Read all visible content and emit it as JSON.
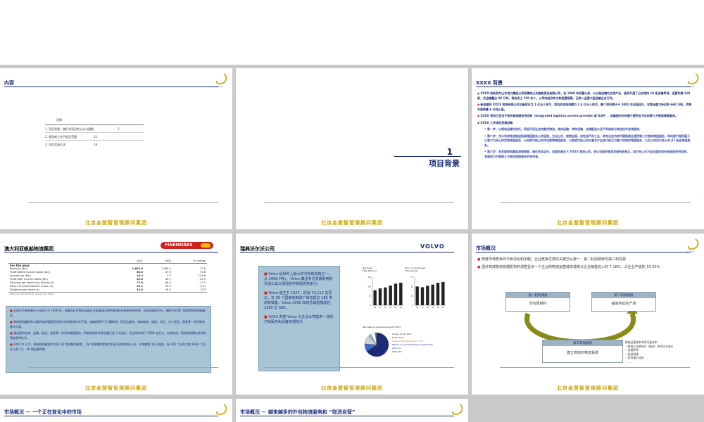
{
  "slide1": {
    "title": "内容",
    "toc_heading": "页数",
    "toc": [
      {
        "label": "1. 项目背景－我们对项目的认识与理解",
        "page": "3"
      },
      {
        "label": "2. 建设新工作目标及范围",
        "page": "11"
      },
      {
        "label": "3. 项目实施方法",
        "page": "18"
      }
    ],
    "footer": "北京金盟智管理顾问集团"
  },
  "slide2": {
    "number": "1",
    "heading": "项目背景",
    "footer": "北京金盟智管理顾问集团"
  },
  "slide3": {
    "title": "XXXX 背景",
    "bullets": [
      "XXXX 的前身为山东电力集团公司所属的山东鲁能货运有限公司，自 1998 年初建以来，以公路运输为主导产业，逐步开通了山东境内 10 条运输专线，运营车辆 218 部，月运输量达 40 万吨，现有员工 350 余人，公司的经济实力和经营规模，已跻入全国大型运输企业行列。",
      "新组建的 XXXX 物流有限公司注册资本为 1 亿元人民币，项目的总投资额为 2.4 亿元人民币，整个项目预计于 2002 年全面运行，年营业额力争达到 660 万吨，货物年周转量 6 亿吨公里。",
      "XXXX 将自己定位于综合物流服务供应商（integrated logistics service provider 或 ILSP），向集团内外的客户提供全方位的第三方物流增值服务。",
      "XXXX 三步走的发展战略"
    ],
    "sub_bullets": [
      "第一步：以煤炭运输为依托，积极开拓社会的散货物流、液体运输、特种运输、仓储配送以及汽车维修与物流技术咨询服务。",
      "第二步：充分利用物流推进拓展增值服务上的经验，立足山东，放眼全国，向包括汽车工业、家电业在内的中国制造业提供第三方物流增值服务，将向客户提供基于以客户为核心的定制增值服务，以采购为核心的市场营销增值服务，以制造为核心的对基本产品进行修正为客户定制的增值服务，以及以时间为核心的 JIT 配送增值服务。",
      "第三步：将发展物流集团战略联盟，通过资本运作，迅速发展壮大 XXXX 物流公司，使公司络合物流发展的新高点，成为在山东乃至全国的综合物流服务供应商，发展成为中国第三方物流增值服务的领导者。"
    ],
    "footer": "北京金盟智管理顾问集团"
  },
  "slide4": {
    "title": "澳大利亚帆船物流集团",
    "brand": "FINEMORES",
    "table_head": [
      "",
      "2001",
      "2000",
      "% change"
    ],
    "table_section": "For the year",
    "table_rows": [
      [
        "Revenue ($m)",
        "1,602.8",
        "1,360.1",
        "17.8"
      ],
      [
        "Profit before income taxes ($m)",
        "66.0",
        "47.9",
        "37.8"
      ],
      [
        "Income tax ($m)",
        "16.4",
        "7.3",
        "124.6"
      ],
      [
        "Profit after income taxes ($m)",
        "49.6",
        "40.7",
        "21.9"
      ],
      [
        "Earnings per share fully diluted (¢)",
        "77.9",
        "66.3",
        "17.3"
      ],
      [
        "Return on shareholders' funds (%)",
        "25.1",
        "25.5",
        "(1.9)"
      ],
      [
        "Dividends per share (¢)",
        "33.0",
        "28.0",
        "17.9"
      ]
    ],
    "table_note": "Best ever Toll Holdings' result since listing",
    "bullets": [
      "总部位于新南威尔士州成立于 1966 年，该集团从传统的运输企业发展成为提供物流综合服务的供应商，向包括通用汽车、福特汽车等厂商提供物流增值服务。",
      "帆船物流集团有丰富的物流管理经验和先进的物流技术手段，该集团提供了冷藏物流、危险品物流、液体物流、煤炭、农业、化工制品、粮食等一系列物流解决方案。",
      "通过提供仓储、运输、配送、信息等一系列的增值服务，帆船物流的年营业额已经 3 亿澳元，在全球有用了 2000 名员工，在物流业，帆船物流拥有多项的荣誉多种技术。",
      "2001 年 3 月，帆船物流被澳大利亚 Toll 物流集团收购， Toll 物流集团是澳大利亚领先的物流公司，年销售额 16 亿美金，有 300 个运作点和 9000 个员工以及 13， 00 辆运输车辆"
    ],
    "footer": "北京金盟智管理顾问集团"
  },
  "slide5": {
    "title": "瑞典沃尔沃公司",
    "brand": "VOLVO",
    "paragraphs": [
      "Volvo 是世界上最大的汽车制造商之一，从 1999 开始， Volvo 集团专注发展商用的交通工具以加强协作和提高竞争力。",
      "Volvo 成立于 1927，现有 74,112 名员工，在 25 个国家有制造厂和在超过 185 市场有销售。Volvo 2000 年的总销售额超过 1300 亿 SEK。",
      "XXXX 希望 Volvo 为企业公司提供一流的汽车服务和设备管理技术"
    ],
    "chart_data": [
      {
        "type": "bar",
        "title": "Net Sales (SEK Billions)",
        "categories": [
          "96",
          "97",
          "98",
          "99",
          "00",
          "01"
        ],
        "values": [
          80,
          90,
          95,
          105,
          115,
          120
        ],
        "ylim": [
          0,
          150
        ],
        "yticks": [
          "0",
          "50",
          "100",
          "150"
        ]
      },
      {
        "type": "bar",
        "title": "Num. of employees (Thousands)",
        "categories": [
          "96",
          "97",
          "98",
          "99",
          "00",
          "01"
        ],
        "values": [
          50,
          48,
          52,
          55,
          60,
          62
        ],
        "ylim": [
          0,
          75
        ],
        "yticks": [
          "0",
          "25",
          "50",
          "75"
        ]
      },
      {
        "type": "pie",
        "title": "Net sales by business area Q3 2001",
        "labels": [
          "Global Trucks 66%",
          "Buses 10%",
          "Construction Equipment 12%",
          "Marine & Industrial Power Systems 4%",
          "Aero 6%",
          "Other 2%"
        ],
        "values": [
          66,
          10,
          12,
          4,
          6,
          2
        ],
        "colors": [
          "#1b2b7a",
          "#3b6ecb",
          "#d0d0d0",
          "#8fb0e0",
          "#ffffff",
          "#666666"
        ]
      }
    ],
    "footer": "北京金盟智管理顾问集团"
  },
  "slide6": {
    "title": "市场概况",
    "bullets": [
      "随着市场竞争的不断深化和加剧，企业竞争优势的关键已从第一、第二利润源转向第三利润源",
      "国外权威物流管理机构的调查显示一个企业的物流运营成本通常占企业销售收入的 7-16%，占企业产值的 10-35%"
    ],
    "cycle": [
      {
        "head": "第一利润源泉",
        "body": "节约原材料"
      },
      {
        "head": "第二利润源泉",
        "body": "提高劳动生产率"
      },
      {
        "head": "第三利润源泉",
        "body": "建立高效的物流系统"
      }
    ],
    "side_note_title": "物流运营成本中的可变成本：",
    "side_notes": [
      "－物流工作单执行（配送）的劳动力成本",
      "－运输声明",
      "－配送网络",
      "－库存报价成本",
      "－……"
    ],
    "footer": "北京金盟智管理顾问集团"
  },
  "slide7": {
    "title": "市场概况 － 一个正在变化中的市场"
  },
  "slide8": {
    "title": "市场概况 － 越来越多的外包物流服务和 “取消自营”"
  },
  "colors": {
    "navy": "#1b2b7a",
    "gold": "#c9a400",
    "red": "#d0201f",
    "blue_box": "#a9c4d6"
  }
}
